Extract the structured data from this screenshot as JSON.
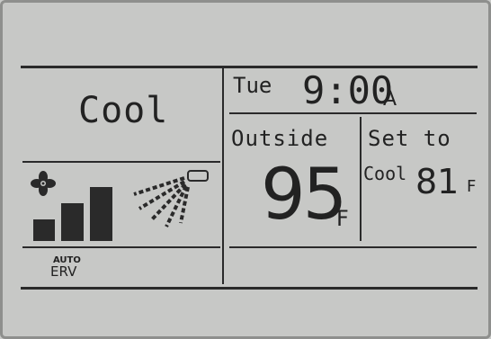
{
  "display": {
    "mode": "Cool",
    "day": "Tue",
    "time": "9:00",
    "ampm": "A",
    "outside": {
      "label": "Outside",
      "temperature": "95",
      "unit": "F"
    },
    "set_to": {
      "label": "Set to",
      "mode": "Cool",
      "temperature": "81",
      "unit": "F"
    },
    "auto_label": "AUTO",
    "erv_label": "ERV",
    "fan_speed_level": "3 of 3 bars",
    "icons": {
      "fan": "fan-icon",
      "airflow": "airflow-vent-icon"
    },
    "colors": {
      "lcd_background": "#c7c8c6",
      "segment": "#222222"
    }
  }
}
